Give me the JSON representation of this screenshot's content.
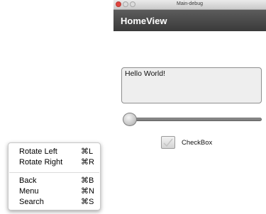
{
  "window": {
    "title": "Main-debug",
    "nav_title": "HomeView"
  },
  "textarea": {
    "value": "Hello World!"
  },
  "slider": {
    "value": 0.0
  },
  "checkbox": {
    "label": "CheckBox",
    "checked": false
  },
  "menu": {
    "items": [
      {
        "label": "Rotate Left",
        "shortcut": "⌘L"
      },
      {
        "label": "Rotate Right",
        "shortcut": "⌘R"
      },
      {
        "label": "Back",
        "shortcut": "⌘B"
      },
      {
        "label": "Menu",
        "shortcut": "⌘N"
      },
      {
        "label": "Search",
        "shortcut": "⌘S"
      }
    ]
  },
  "colors": {
    "navbar": "#4a4a4a",
    "close_button": "#e0443e"
  }
}
